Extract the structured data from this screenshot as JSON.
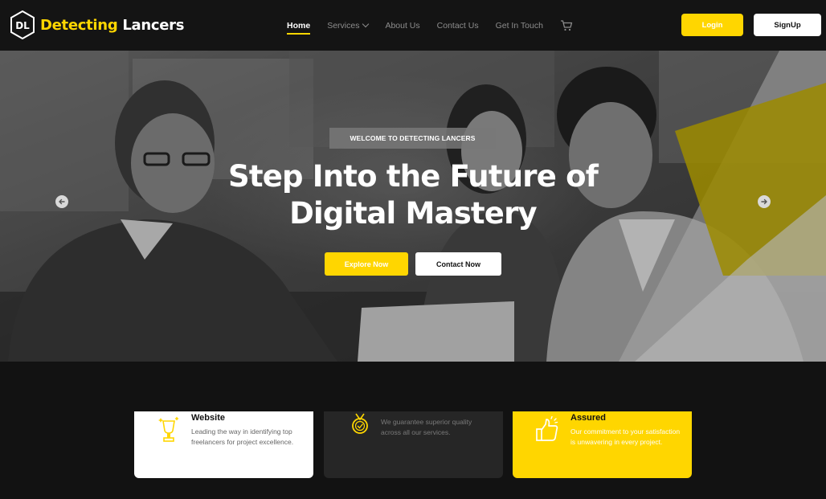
{
  "brand": {
    "name_part1": "Detecting",
    "name_part2": "Lancers",
    "logo_letters": "DL",
    "accent_color": "#ffd600"
  },
  "nav": {
    "items": [
      {
        "label": "Home",
        "active": true
      },
      {
        "label": "Services",
        "has_dropdown": true
      },
      {
        "label": "About Us"
      },
      {
        "label": "Contact Us"
      },
      {
        "label": "Get In Touch"
      }
    ],
    "cart_icon": "cart-icon",
    "login_label": "Login",
    "signup_label": "SignUp"
  },
  "hero": {
    "badge": "WELCOME TO DETECTING LANCERS",
    "title_line1": "Step Into the Future of",
    "title_line2": "Digital Mastery",
    "explore_label": "Explore Now",
    "contact_label": "Contact Now",
    "prev_icon": "arrow-left-icon",
    "next_icon": "arrow-right-icon"
  },
  "features": [
    {
      "title": "Website",
      "description": "Leading the way in identifying top freelancers for project excellence.",
      "icon": "trophy-icon",
      "theme": "white"
    },
    {
      "title": "",
      "description": "We guarantee superior quality across all our services.",
      "icon": "medal-icon",
      "theme": "dark"
    },
    {
      "title": "Assured",
      "description": "Our commitment to your satisfaction is unwavering in every project.",
      "icon": "thumbs-up-icon",
      "theme": "yellow"
    }
  ]
}
